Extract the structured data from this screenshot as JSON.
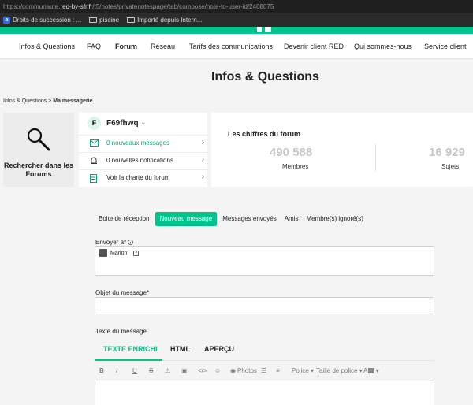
{
  "browser": {
    "url_prefix": "https://communaute.",
    "url_host": "red-by-sfr.fr",
    "url_path": "/t5/notes/privatenotespage/tab/compose/note-to-user-id/2408075",
    "bookmarks": [
      "Droits de succession : ...",
      "piscine",
      "Importé depuis Intern..."
    ]
  },
  "nav": [
    "Infos & Questions",
    "FAQ",
    "Forum",
    "Réseau",
    "Tarifs des communications",
    "Devenir client RED",
    "Qui sommes-nous",
    "Service client"
  ],
  "page_title": "Infos & Questions",
  "breadcrumb": {
    "root": "Infos & Questions",
    "sep": ">",
    "current": "Ma messagerie"
  },
  "search_card": {
    "label": "Rechercher dans les Forums"
  },
  "user": {
    "initial": "F",
    "name": "F69fhwq",
    "rows": [
      {
        "label": "0 nouveaux messages"
      },
      {
        "label": "0 nouvelles notifications"
      },
      {
        "label": "Voir la charte du forum"
      }
    ]
  },
  "stats": {
    "title": "Les chiffres du forum",
    "members_value": "490 588",
    "members_label": "Membres",
    "subjects_value": "16 929",
    "subjects_label": "Sujets"
  },
  "tabs": [
    "Boite de réception",
    "Nouveau message",
    "Messages envoyés",
    "Amis",
    "Membre(s) ignoré(s)"
  ],
  "form": {
    "to_label": "Envoyer à*",
    "recipient": "Marion",
    "subject_label": "Objet du message*",
    "body_label": "Texte du message",
    "editor_tabs": [
      "TEXTE ENRICHI",
      "HTML",
      "APERÇU"
    ],
    "toolbar": {
      "photos": "Photos",
      "font": "Police",
      "font_size": "Taille de police",
      "color_letter": "A"
    }
  },
  "colors": {
    "accent": "#00c48c"
  }
}
